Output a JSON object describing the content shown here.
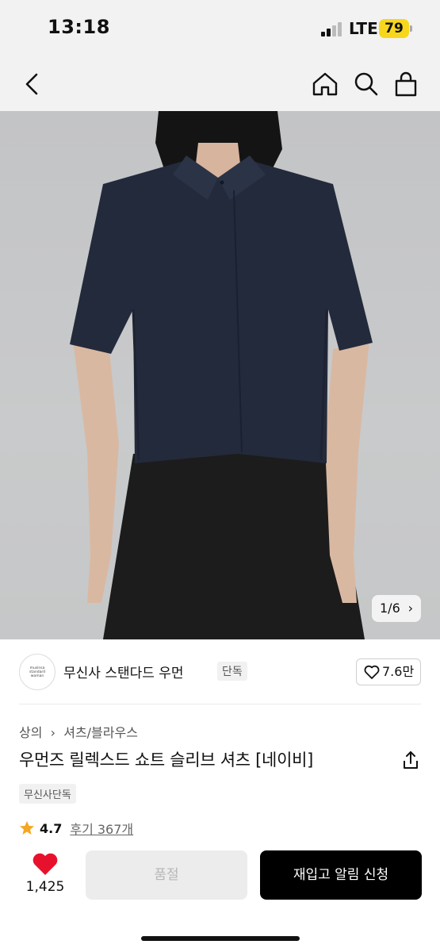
{
  "status_bar": {
    "time": "13:18",
    "network": "LTE",
    "battery": "79"
  },
  "hero": {
    "counter": "1/6"
  },
  "brand": {
    "logo_text": "musinsa standard woman",
    "name": "무신사 스탠다드 우먼",
    "badge": "단독",
    "likes": "7.6만"
  },
  "product": {
    "breadcrumb": [
      "상의",
      "셔츠/블라우스"
    ],
    "title": "우먼즈 릴렉스드 쇼트 슬리브 셔츠 [네이비]",
    "tag": "무신사단독",
    "rating": "4.7",
    "reviews": "후기 367개"
  },
  "bottom": {
    "heart_count": "1,425",
    "soldout_label": "품절",
    "restock_label": "재입고 알림 신청"
  },
  "colors": {
    "accent_red": "#e8112d",
    "star": "#f5a623",
    "shirt": "#232a3b"
  }
}
